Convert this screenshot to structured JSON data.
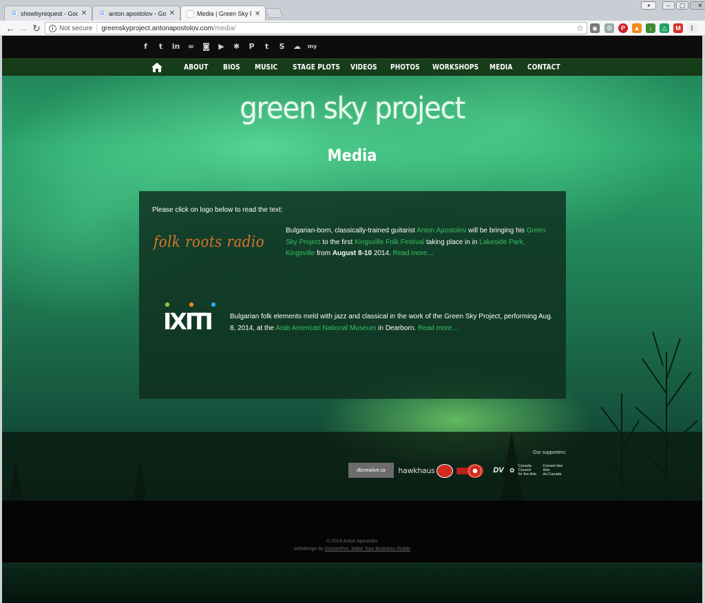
{
  "browser": {
    "tabs": [
      {
        "title": "showbyrequest - Google Se",
        "active": false
      },
      {
        "title": "anton apostolov - Google S",
        "active": false
      },
      {
        "title": "Media | Green Sky Project",
        "active": true
      }
    ],
    "security_label": "Not secure",
    "url_host": "greenskyproject.antonapostolov.com",
    "url_path": "/media/"
  },
  "site": {
    "nav_items": [
      "ABOUT",
      "BIOS",
      "MUSIC",
      "STAGE PLOTS",
      "VIDEOS",
      "PHOTOS",
      "WORKSHOPS",
      "MEDIA",
      "CONTACT"
    ],
    "social_icons": [
      "facebook-icon",
      "twitter-icon",
      "linkedin-icon",
      "lastfm-icon",
      "instagram-icon",
      "youtube-icon",
      "reverbnation-icon",
      "pinterest-icon",
      "tumblr-icon",
      "skype-icon",
      "soundcloud-icon",
      "myspace-icon"
    ],
    "logo_text": "green sky project",
    "heading": "Media",
    "intro": "Please click on logo below to read the text:",
    "article1": {
      "logo_text": "folk roots radio",
      "t1": "Bulgarian-born, classically-trained guitarist ",
      "l1": "Anton Apostolov",
      "t2": " will be bringing his ",
      "l2": "Green Sky Project",
      "t3": " to the first ",
      "l3": "Kingsville Folk Festival",
      "t4": " taking place in in ",
      "l4": "Lakeside Park, Kingsville",
      "t5": " from ",
      "b1": "August 8-10",
      "t6": " 2014. ",
      "l5": "Read more…"
    },
    "article2": {
      "logo_text": "IXITI",
      "t1": "Bulgarian folk elements meld with jazz and classical in the work of the Green Sky Project, performing Aug. 8, 2014, at the ",
      "l1": "Arab American National Museum",
      "t2": " in Dearborn. ",
      "l2": "Read more…"
    },
    "supporters_label": "Our supporters:",
    "supporters": {
      "db": "dbcreative.ca",
      "hh": "hawkhaus",
      "dv": "DV",
      "cc1": "Canada Council",
      "cc2": "for the Arts",
      "cc3": "Conseil des Arts",
      "cc4": "du Canada"
    },
    "copyright": "© 2014 Anton Apostolov",
    "webdesign_prefix": "webdesign by ",
    "webdesign_link": "InvisionPro. Make Your Business Visible"
  },
  "colors": {
    "accent_link": "#38c15f",
    "nav_bg": "#173c19",
    "topbar_bg": "#0d0d0d",
    "folk_roots_orange": "#d9762b"
  }
}
